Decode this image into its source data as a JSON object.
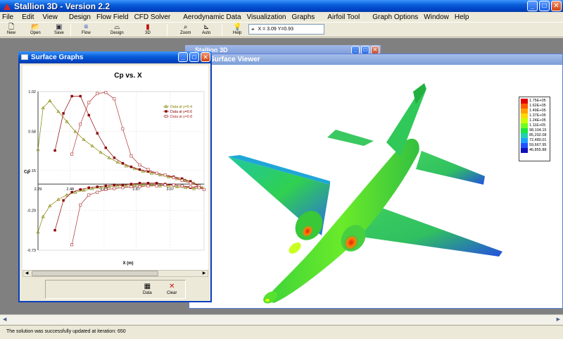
{
  "app": {
    "title": "Stallion 3D - Version 2.2"
  },
  "menu": [
    "File",
    "Edit",
    "View",
    "Design",
    "Flow Field",
    "CFD Solver",
    "Aerodynamic Data",
    "Visualization",
    "Graphs",
    "Airfoil Tool",
    "Graph Options",
    "Window",
    "Help"
  ],
  "toolbar": {
    "new": "New",
    "open": "Open",
    "save": "Save",
    "flow": "Flow",
    "design": "Design",
    "view3d": "3D",
    "zoom": "Zoom",
    "auto": "Auto",
    "help": "Help",
    "coordinates": "X = 3.09  Y=0.93"
  },
  "windows": {
    "minimized_title": "Stallion 3D",
    "viewer_title": "Surface Viewer",
    "graphs_title": "Surface Graphs"
  },
  "graph_panel": {
    "data_button": "Data",
    "clear_button": "Clear"
  },
  "legend": {
    "values": [
      "1.75E+05",
      "1.62E+05",
      "1.49E+05",
      "1.37E+05",
      "1.24E+05",
      "1.11E+05",
      "98,104.15",
      "85,292.08",
      "72,480.01",
      "59,667.95",
      "46,855.88"
    ],
    "colors": [
      "#e00000",
      "#ff5a00",
      "#ffa000",
      "#ffd800",
      "#c8ff00",
      "#6eff1e",
      "#18e640",
      "#20d0b0",
      "#1ea0ff",
      "#2050ff",
      "#1010b8"
    ]
  },
  "status": {
    "message": "The solution was successfully updated at iteration: 650"
  },
  "chart_data": {
    "type": "line",
    "title": "Cp vs. X",
    "xlabel": "X (m)",
    "ylabel": "Cp",
    "xlim": [
      2.29,
      3.27
    ],
    "ylim": [
      -0.73,
      1.02
    ],
    "x_ticks": [
      "2.29",
      "2.48",
      "2.68",
      "2.87",
      "3.07"
    ],
    "y_ticks": [
      "1.02",
      "0.58",
      "0.15",
      "-0.29",
      "-0.73"
    ],
    "legend_position": "top-right",
    "series": [
      {
        "name": "Data at y=0.4",
        "color": "#808000",
        "marker": "triangle",
        "x": [
          2.29,
          2.32,
          2.36,
          2.41,
          2.46,
          2.51,
          2.56,
          2.61,
          2.66,
          2.71,
          2.76,
          2.81,
          2.86,
          2.91,
          2.96,
          3.01,
          3.06,
          3.11,
          3.16,
          3.21,
          3.26,
          3.21,
          3.16,
          3.11,
          3.06,
          3.01,
          2.96,
          2.91,
          2.86,
          2.81,
          2.76,
          2.71,
          2.66,
          2.61,
          2.56,
          2.51,
          2.46,
          2.41,
          2.36,
          2.32,
          2.29
        ],
        "y": [
          0.38,
          0.84,
          0.92,
          0.8,
          0.69,
          0.58,
          0.49,
          0.42,
          0.35,
          0.29,
          0.24,
          0.2,
          0.17,
          0.14,
          0.12,
          0.1,
          0.08,
          0.06,
          0.04,
          0.01,
          -0.04,
          -0.05,
          -0.04,
          -0.03,
          -0.02,
          -0.02,
          -0.01,
          -0.01,
          -0.01,
          -0.02,
          -0.02,
          -0.03,
          -0.04,
          -0.05,
          -0.07,
          -0.09,
          -0.12,
          -0.17,
          -0.24,
          -0.36,
          -0.53
        ]
      },
      {
        "name": "Data at y=0.6",
        "color": "#8b0000",
        "marker": "square",
        "x": [
          2.39,
          2.44,
          2.49,
          2.54,
          2.59,
          2.64,
          2.69,
          2.74,
          2.79,
          2.84,
          2.89,
          2.94,
          2.99,
          3.04,
          3.09,
          3.14,
          3.19,
          3.24,
          3.19,
          3.14,
          3.09,
          3.04,
          2.99,
          2.94,
          2.89,
          2.84,
          2.79,
          2.74,
          2.69,
          2.64,
          2.59,
          2.54,
          2.49,
          2.44,
          2.39
        ],
        "y": [
          0.37,
          0.78,
          0.97,
          0.97,
          0.76,
          0.56,
          0.4,
          0.29,
          0.23,
          0.19,
          0.16,
          0.14,
          0.12,
          0.1,
          0.08,
          0.06,
          0.03,
          -0.02,
          -0.04,
          -0.02,
          -0.01,
          0.0,
          0.01,
          0.01,
          0.01,
          0.0,
          -0.01,
          -0.01,
          -0.02,
          -0.03,
          -0.04,
          -0.06,
          -0.09,
          -0.18,
          -0.51
        ]
      },
      {
        "name": "Data at y=0.8",
        "color": "#b03030",
        "marker": "hollow-square",
        "x": [
          2.49,
          2.54,
          2.59,
          2.64,
          2.69,
          2.74,
          2.79,
          2.84,
          2.89,
          2.94,
          2.99,
          3.04,
          3.09,
          3.14,
          3.19,
          3.24,
          3.27,
          3.24,
          3.19,
          3.14,
          3.09,
          3.04,
          2.99,
          2.94,
          2.89,
          2.84,
          2.79,
          2.74,
          2.69,
          2.64,
          2.59,
          2.54,
          2.49
        ],
        "y": [
          0.33,
          0.66,
          0.9,
          1.0,
          1.01,
          0.94,
          0.61,
          0.31,
          0.21,
          0.16,
          0.12,
          0.1,
          0.07,
          0.04,
          0.01,
          -0.02,
          -0.06,
          -0.04,
          -0.03,
          -0.02,
          -0.01,
          -0.01,
          -0.02,
          -0.02,
          -0.03,
          -0.03,
          -0.04,
          -0.05,
          -0.06,
          -0.09,
          -0.12,
          -0.23,
          -0.67
        ]
      }
    ]
  }
}
